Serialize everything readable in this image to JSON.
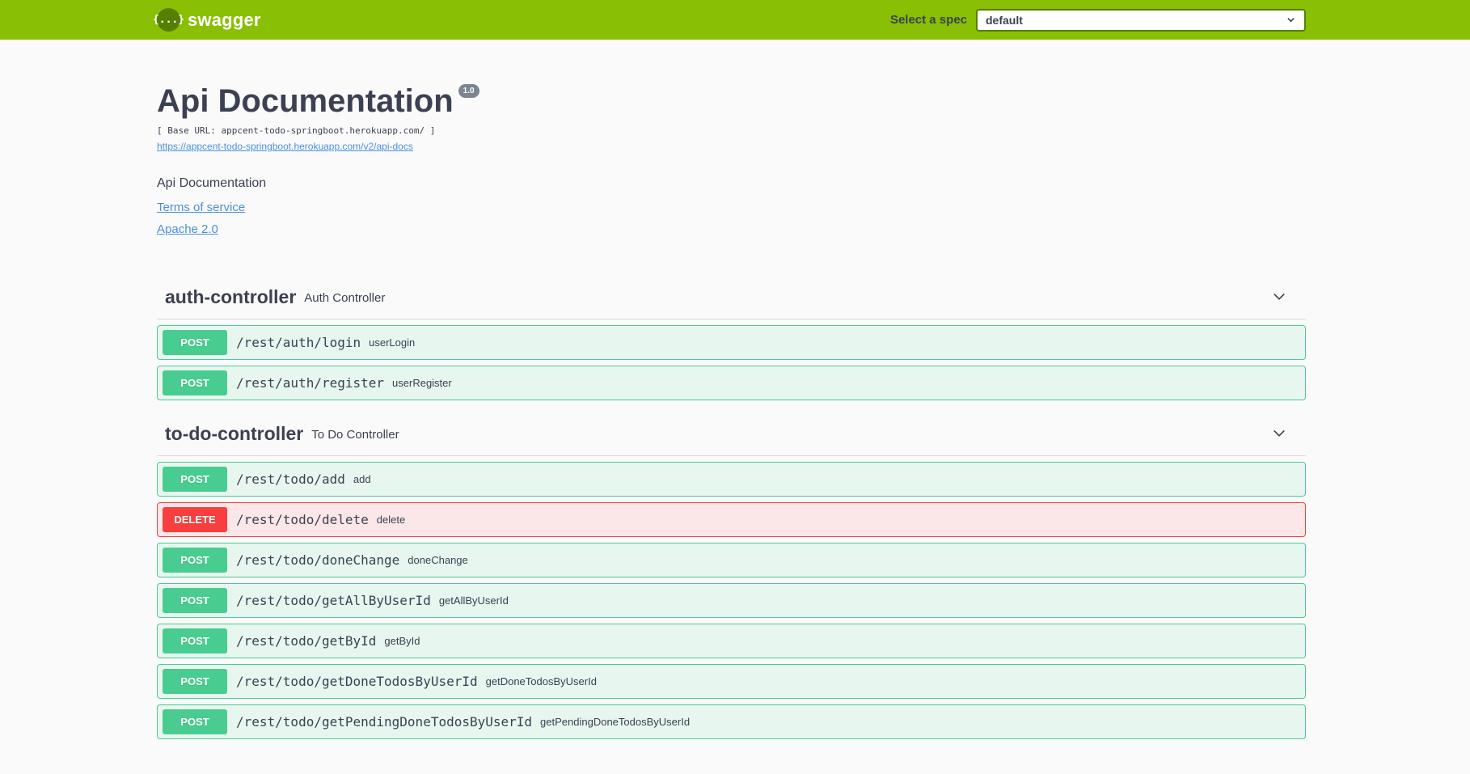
{
  "topbar": {
    "brand_icon": "{...}",
    "brand_name": "swagger",
    "spec_label": "Select a spec",
    "spec_value": "default",
    "colors": {
      "bar": "#89bf04",
      "accent": "#547f00"
    }
  },
  "info": {
    "title": "Api Documentation",
    "version": "1.0",
    "base_url": "[ Base URL: appcent-todo-springboot.herokuapp.com/ ]",
    "api_docs_link": "https://appcent-todo-springboot.herokuapp.com/v2/api-docs",
    "description": "Api Documentation",
    "terms": "Terms of service",
    "license": "Apache 2.0"
  },
  "tags": [
    {
      "name": "auth-controller",
      "description": "Auth Controller",
      "operations": [
        {
          "method": "POST",
          "path": "/rest/auth/login",
          "id": "userLogin"
        },
        {
          "method": "POST",
          "path": "/rest/auth/register",
          "id": "userRegister"
        }
      ]
    },
    {
      "name": "to-do-controller",
      "description": "To Do Controller",
      "operations": [
        {
          "method": "POST",
          "path": "/rest/todo/add",
          "id": "add"
        },
        {
          "method": "DELETE",
          "path": "/rest/todo/delete",
          "id": "delete"
        },
        {
          "method": "POST",
          "path": "/rest/todo/doneChange",
          "id": "doneChange"
        },
        {
          "method": "POST",
          "path": "/rest/todo/getAllByUserId",
          "id": "getAllByUserId"
        },
        {
          "method": "POST",
          "path": "/rest/todo/getById",
          "id": "getById"
        },
        {
          "method": "POST",
          "path": "/rest/todo/getDoneTodosByUserId",
          "id": "getDoneTodosByUserId"
        },
        {
          "method": "POST",
          "path": "/rest/todo/getPendingDoneTodosByUserId",
          "id": "getPendingDoneTodosByUserId"
        }
      ]
    }
  ],
  "method_colors": {
    "POST": "#49cc90",
    "DELETE": "#f93e3e"
  }
}
